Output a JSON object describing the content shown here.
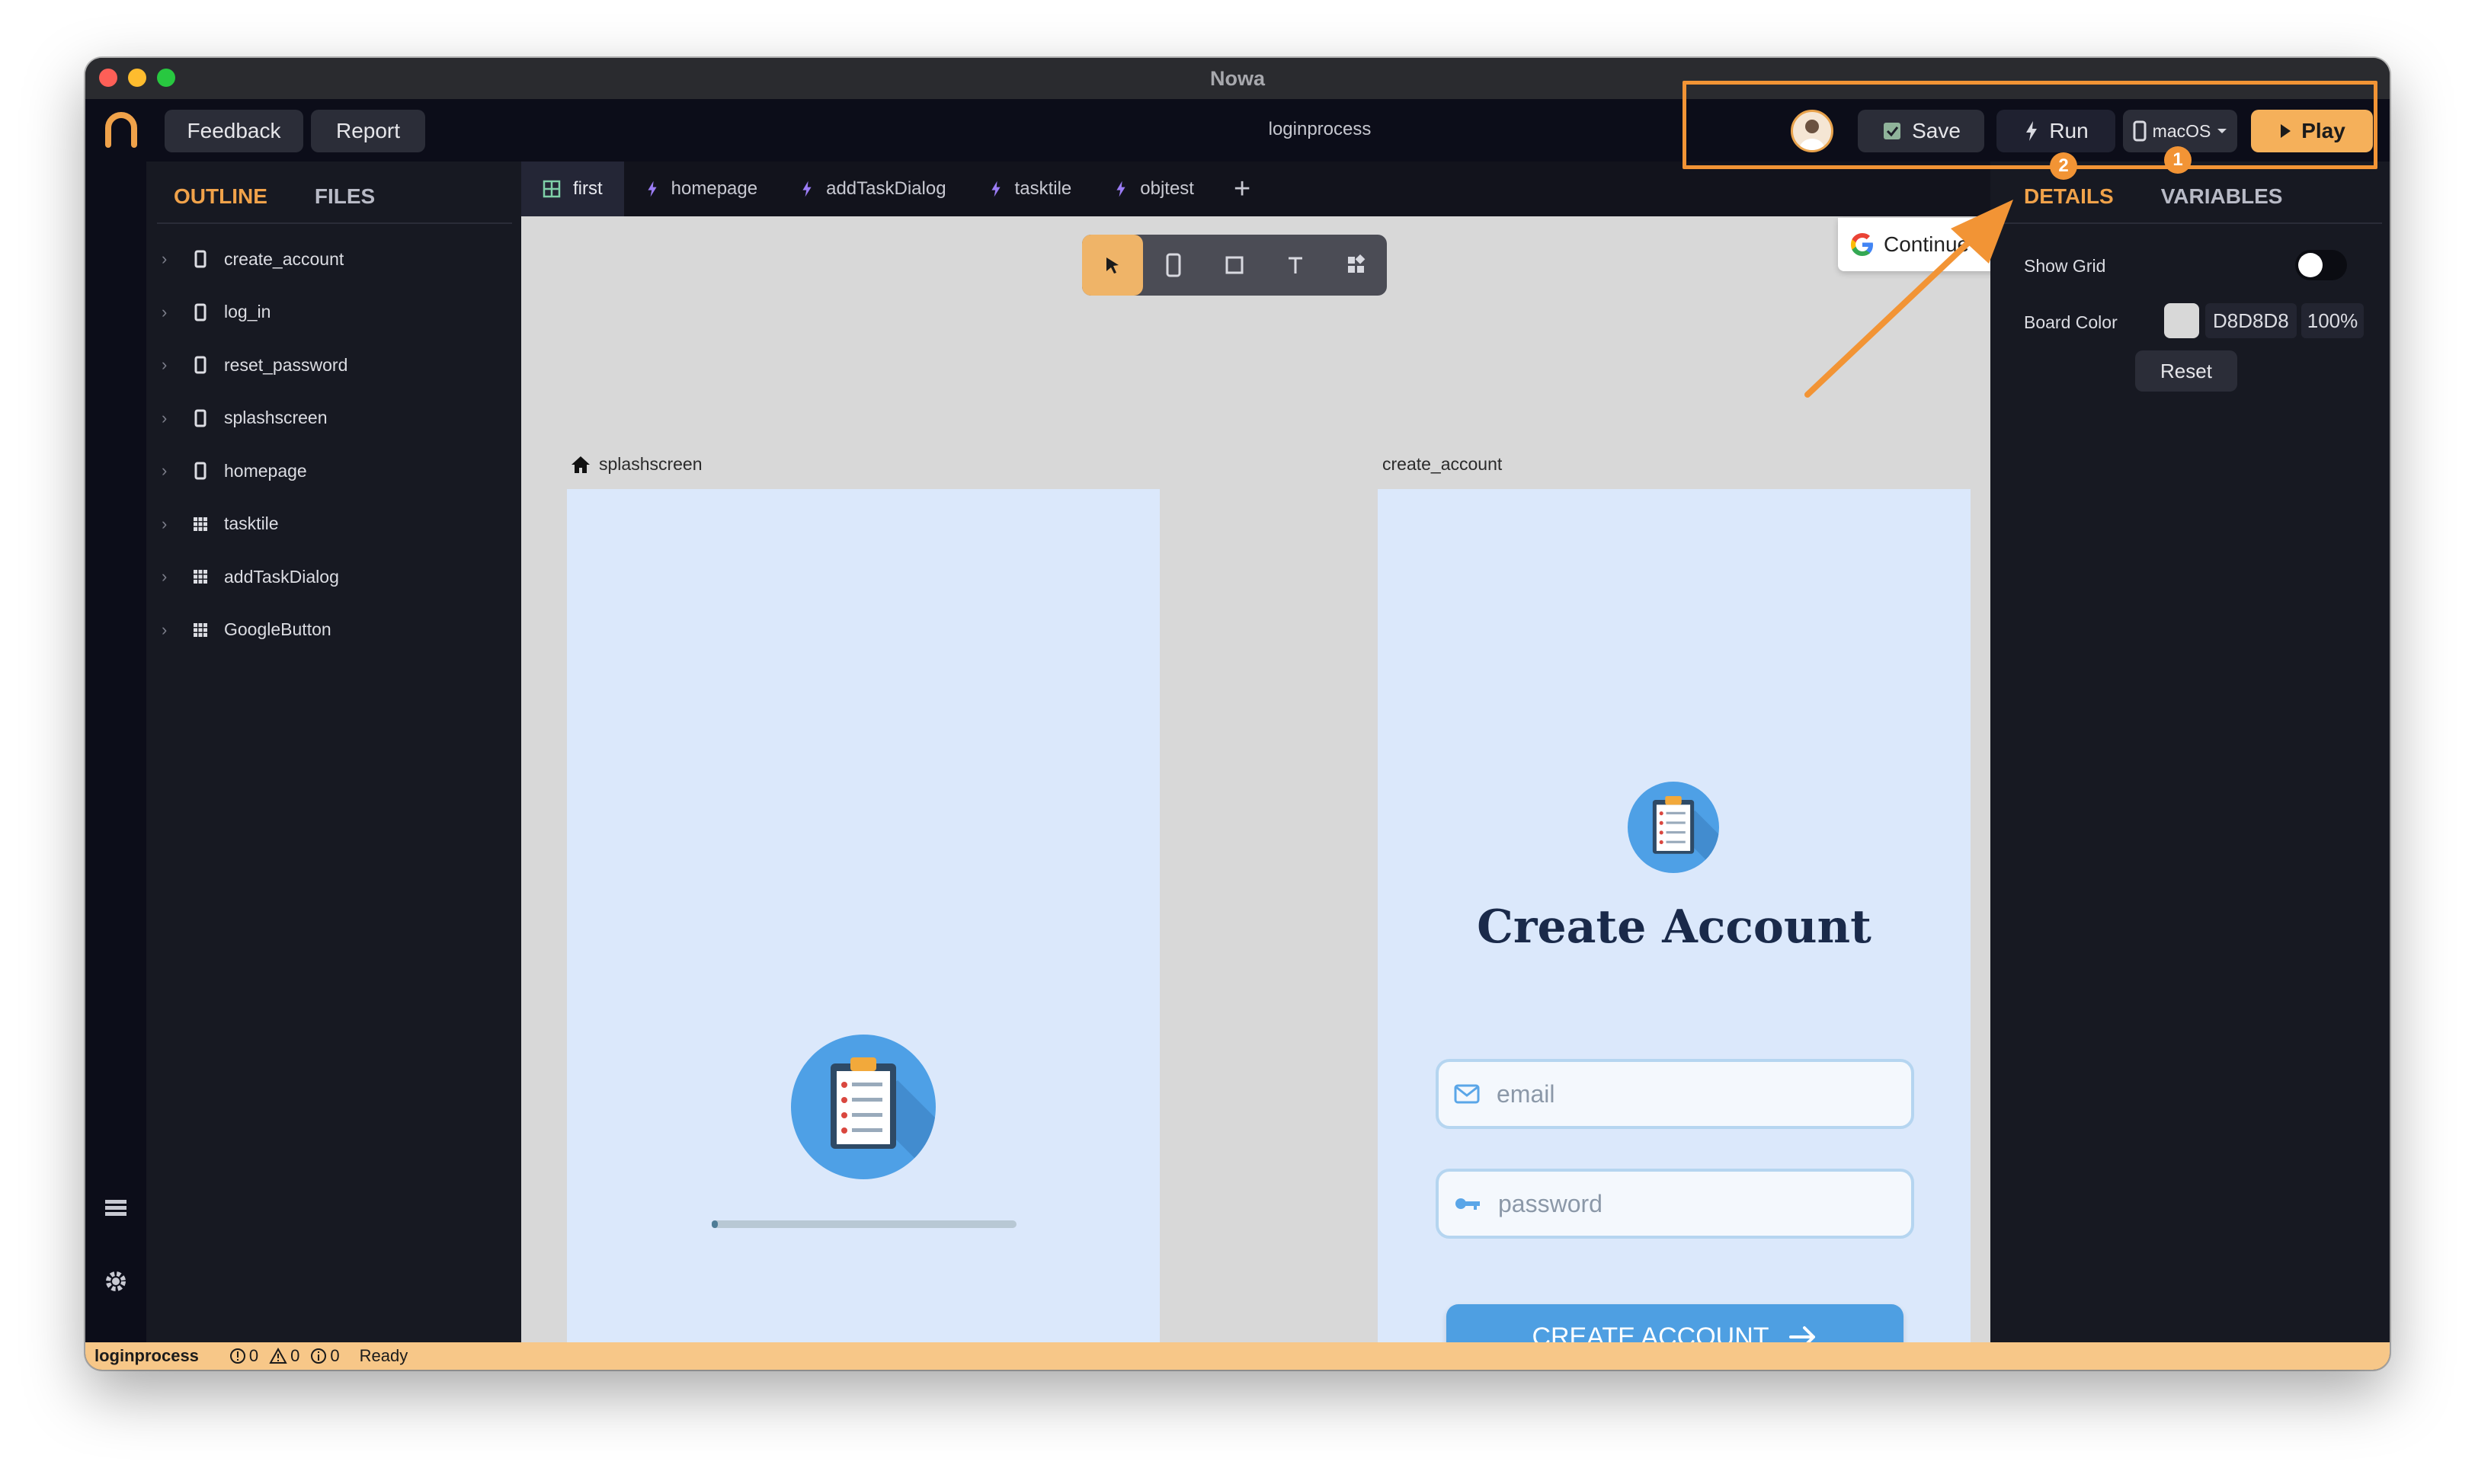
{
  "window": {
    "title": "Nowa"
  },
  "topbar": {
    "feedback_label": "Feedback",
    "report_label": "Report",
    "project_name": "loginprocess",
    "save_label": "Save",
    "run_label": "Run",
    "platform_label": "macOS",
    "play_label": "Play"
  },
  "annotations": {
    "badge_1": "1",
    "badge_2": "2",
    "accent_color": "#f29435"
  },
  "outline_panel": {
    "tabs": [
      "OUTLINE",
      "FILES"
    ],
    "items": [
      {
        "label": "create_account",
        "icon": "phone-icon"
      },
      {
        "label": "log_in",
        "icon": "phone-icon"
      },
      {
        "label": "reset_password",
        "icon": "phone-icon"
      },
      {
        "label": "splashscreen",
        "icon": "phone-icon"
      },
      {
        "label": "homepage",
        "icon": "phone-icon"
      },
      {
        "label": "tasktile",
        "icon": "grid-icon"
      },
      {
        "label": "addTaskDialog",
        "icon": "grid-icon"
      },
      {
        "label": "GoogleButton",
        "icon": "grid-icon"
      }
    ]
  },
  "editor_tabs": {
    "tabs": [
      {
        "label": "first",
        "icon": "grid-icon"
      },
      {
        "label": "homepage",
        "icon": "bolt-icon"
      },
      {
        "label": "addTaskDialog",
        "icon": "bolt-icon"
      },
      {
        "label": "tasktile",
        "icon": "bolt-icon"
      },
      {
        "label": "objtest",
        "icon": "bolt-icon"
      }
    ],
    "add_label": "+"
  },
  "canvas": {
    "google_button_text": "Continue w",
    "splash_label": "splashscreen",
    "create_label": "create_account",
    "splash_progress": 0.02,
    "create_account": {
      "title": "Create Account",
      "email_placeholder": "email",
      "password_placeholder": "password",
      "cta_label": "CREATE ACCOUNT"
    }
  },
  "details_panel": {
    "tabs": [
      "DETAILS",
      "VARIABLES"
    ],
    "show_grid_label": "Show Grid",
    "board_color_label": "Board Color",
    "board_color_hex": "D8D8D8",
    "board_color_opacity": "100%",
    "reset_label": "Reset"
  },
  "statusbar": {
    "project": "loginprocess",
    "errors": "0",
    "warnings": "0",
    "infos": "0",
    "status": "Ready"
  }
}
